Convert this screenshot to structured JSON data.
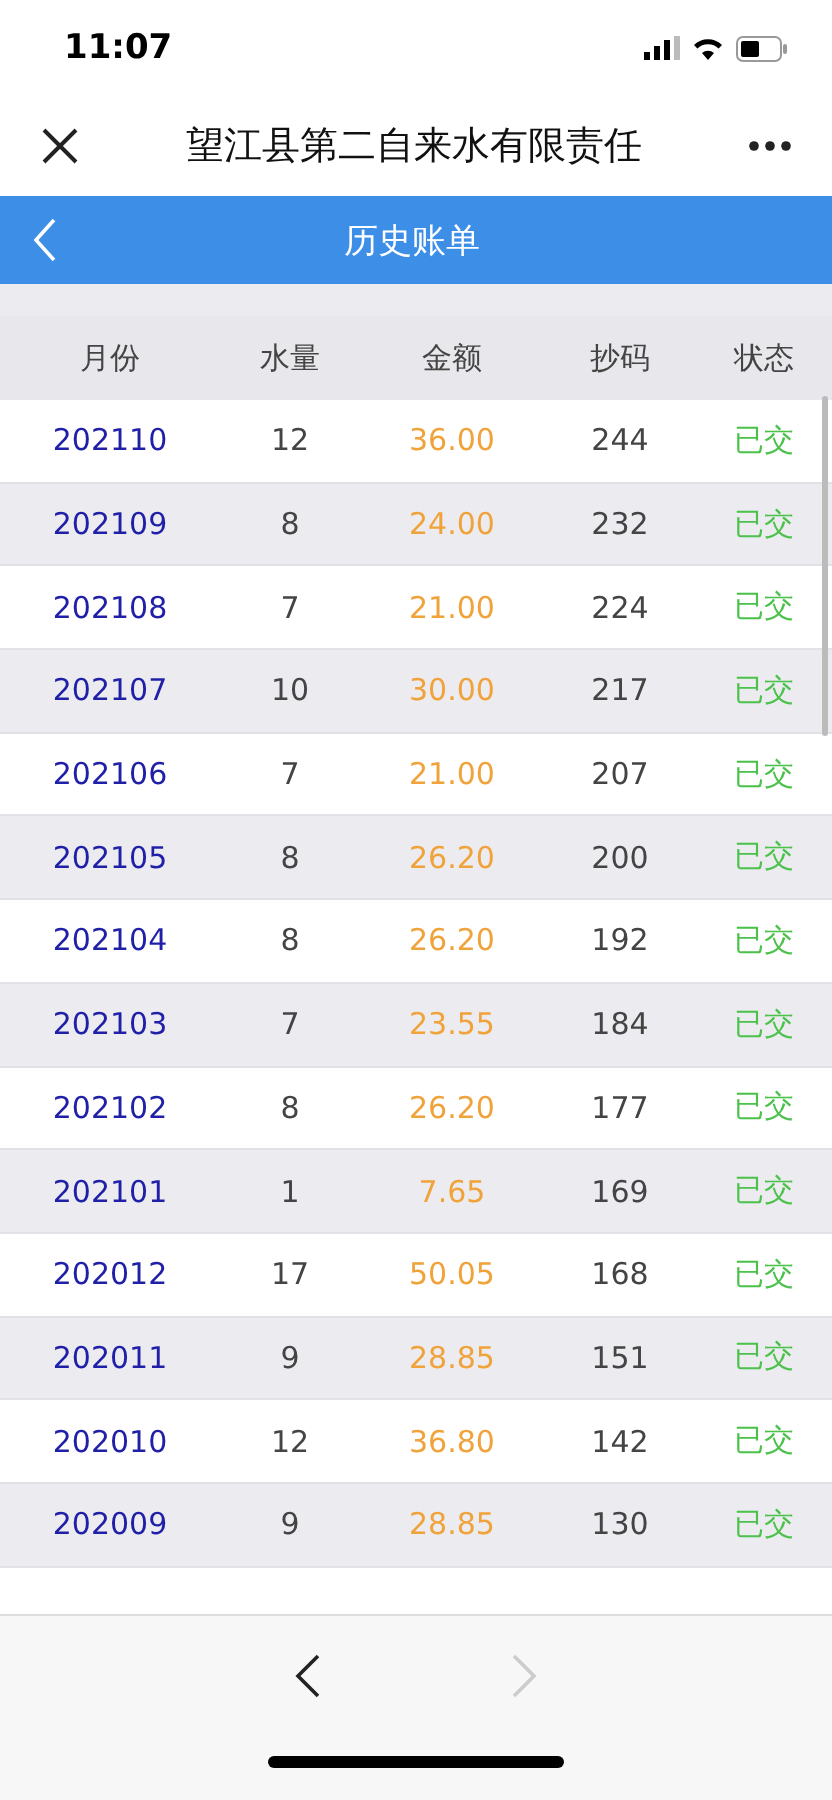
{
  "status_bar": {
    "time": "11:07"
  },
  "nav_bar": {
    "title": "望江县第二自来水有限责任"
  },
  "header": {
    "title": "历史账单"
  },
  "table": {
    "columns": [
      "月份",
      "水量",
      "金额",
      "抄码",
      "状态"
    ],
    "rows": [
      {
        "month": "202110",
        "volume": "12",
        "amount": "36.00",
        "reading": "244",
        "status": "已交"
      },
      {
        "month": "202109",
        "volume": "8",
        "amount": "24.00",
        "reading": "232",
        "status": "已交"
      },
      {
        "month": "202108",
        "volume": "7",
        "amount": "21.00",
        "reading": "224",
        "status": "已交"
      },
      {
        "month": "202107",
        "volume": "10",
        "amount": "30.00",
        "reading": "217",
        "status": "已交"
      },
      {
        "month": "202106",
        "volume": "7",
        "amount": "21.00",
        "reading": "207",
        "status": "已交"
      },
      {
        "month": "202105",
        "volume": "8",
        "amount": "26.20",
        "reading": "200",
        "status": "已交"
      },
      {
        "month": "202104",
        "volume": "8",
        "amount": "26.20",
        "reading": "192",
        "status": "已交"
      },
      {
        "month": "202103",
        "volume": "7",
        "amount": "23.55",
        "reading": "184",
        "status": "已交"
      },
      {
        "month": "202102",
        "volume": "8",
        "amount": "26.20",
        "reading": "177",
        "status": "已交"
      },
      {
        "month": "202101",
        "volume": "1",
        "amount": "7.65",
        "reading": "169",
        "status": "已交"
      },
      {
        "month": "202012",
        "volume": "17",
        "amount": "50.05",
        "reading": "168",
        "status": "已交"
      },
      {
        "month": "202011",
        "volume": "9",
        "amount": "28.85",
        "reading": "151",
        "status": "已交"
      },
      {
        "month": "202010",
        "volume": "12",
        "amount": "36.80",
        "reading": "142",
        "status": "已交"
      },
      {
        "month": "202009",
        "volume": "9",
        "amount": "28.85",
        "reading": "130",
        "status": "已交"
      }
    ]
  },
  "toolbar": {
    "back_disabled": false,
    "forward_disabled": true
  }
}
